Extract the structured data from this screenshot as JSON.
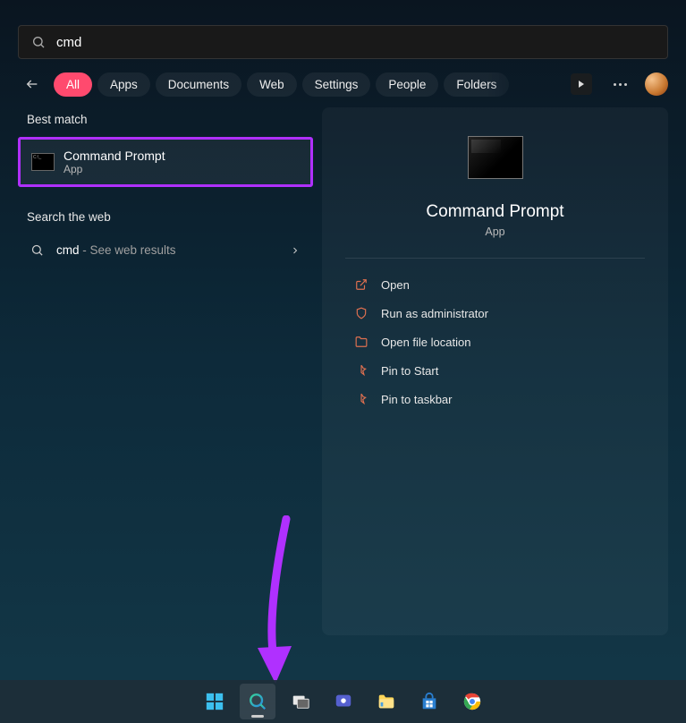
{
  "search": {
    "value": "cmd"
  },
  "filters": {
    "items": [
      "All",
      "Apps",
      "Documents",
      "Web",
      "Settings",
      "People",
      "Folders"
    ],
    "activeIndex": 0
  },
  "sections": {
    "best_match": "Best match",
    "search_web": "Search the web"
  },
  "best": {
    "title": "Command Prompt",
    "subtitle": "App"
  },
  "web": {
    "query": "cmd",
    "suffix": " - See web results"
  },
  "detail": {
    "title": "Command Prompt",
    "subtitle": "App",
    "actions": [
      {
        "icon": "open",
        "label": "Open"
      },
      {
        "icon": "shield",
        "label": "Run as administrator"
      },
      {
        "icon": "folder",
        "label": "Open file location"
      },
      {
        "icon": "pin",
        "label": "Pin to Start"
      },
      {
        "icon": "pin",
        "label": "Pin to taskbar"
      }
    ]
  },
  "taskbar": {
    "items": [
      "start",
      "search",
      "taskview",
      "chat",
      "explorer",
      "store",
      "chrome"
    ],
    "activeIndex": 1
  },
  "colors": {
    "accent": "#ff4a6e",
    "highlight": "#b030ff",
    "action_icon": "#e07050"
  }
}
